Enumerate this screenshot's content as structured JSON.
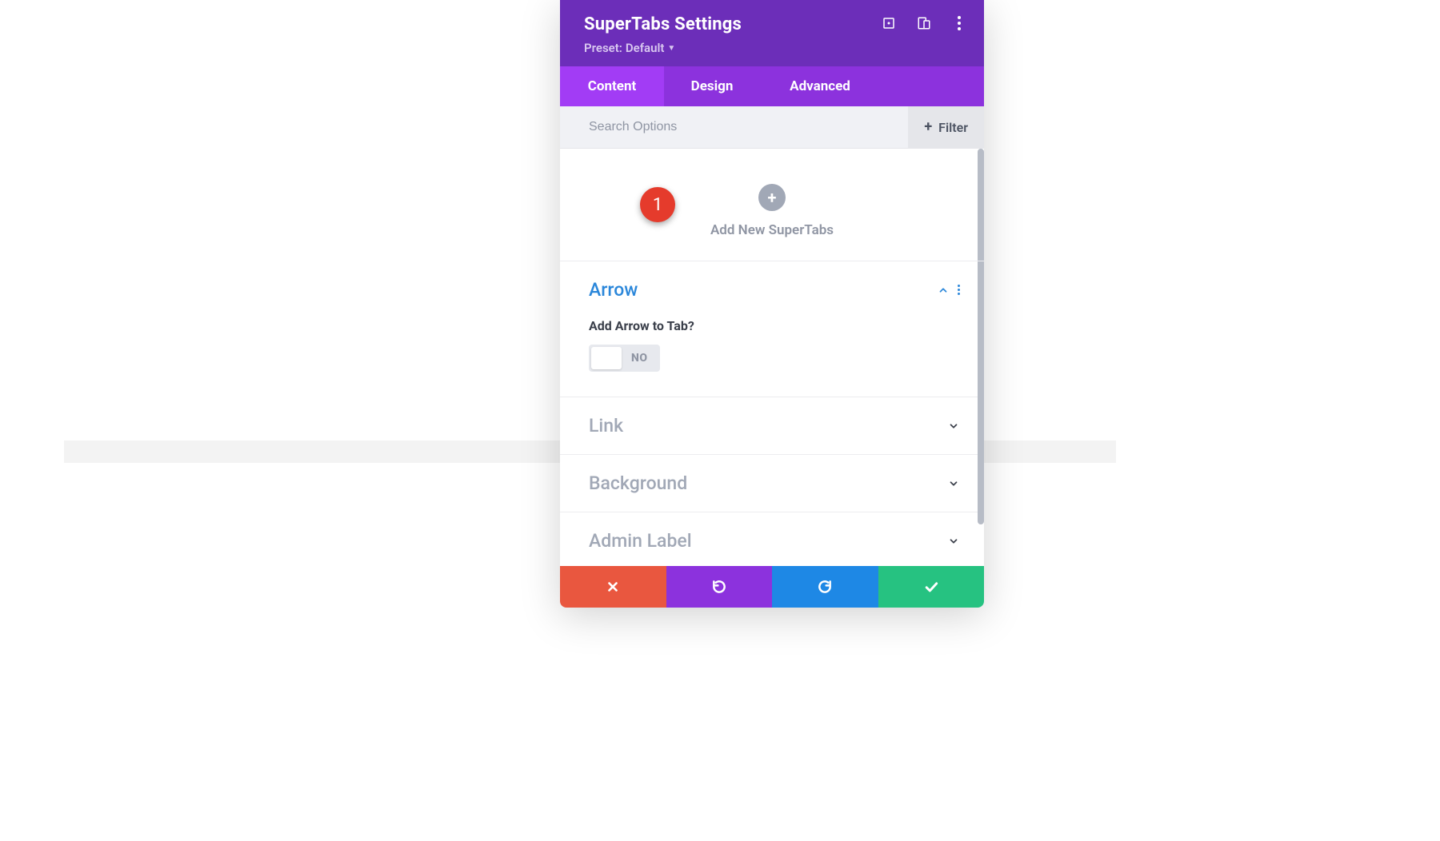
{
  "header": {
    "title": "SuperTabs Settings",
    "preset_prefix": "Preset:",
    "preset_value": "Default"
  },
  "tabs": [
    {
      "label": "Content",
      "active": true
    },
    {
      "label": "Design",
      "active": false
    },
    {
      "label": "Advanced",
      "active": false
    }
  ],
  "search": {
    "placeholder": "Search Options",
    "filter_label": "Filter"
  },
  "callout": {
    "number": "1"
  },
  "add_block": {
    "label": "Add New SuperTabs"
  },
  "sections": [
    {
      "key": "arrow",
      "title": "Arrow",
      "expanded": true,
      "fields": {
        "add_arrow_label": "Add Arrow to Tab?",
        "add_arrow_state": "NO"
      }
    },
    {
      "key": "link",
      "title": "Link",
      "expanded": false
    },
    {
      "key": "background",
      "title": "Background",
      "expanded": false
    },
    {
      "key": "admin_label",
      "title": "Admin Label",
      "expanded": false
    }
  ],
  "colors": {
    "header": "#6c2eb9",
    "tab_bar": "#8c32dd",
    "tab_active": "#a23cf5",
    "accent_blue": "#2b87da",
    "callout": "#e53b2c",
    "cancel": "#e9573f",
    "undo": "#8c32dd",
    "redo": "#1e88e5",
    "save": "#26c281"
  }
}
